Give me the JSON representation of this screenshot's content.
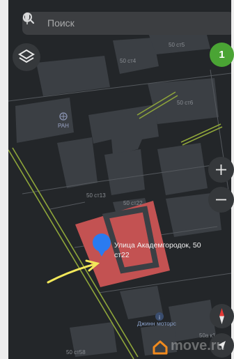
{
  "search": {
    "placeholder": "Поиск"
  },
  "notifications": {
    "count": "1"
  },
  "map": {
    "poi_ran": "РАН",
    "poi_djinn": "Джинн моторс",
    "selected_address_line1": "Улица Академгородок, 50",
    "selected_address_line2": "ст22",
    "building_labels": {
      "st5": "50 ст5",
      "st4": "50 ст4",
      "st6": "50 ст6",
      "st13": "50 ст13",
      "st22": "50 ст22",
      "k1": "50а к1",
      "st58": "50 ст58"
    }
  },
  "watermark": {
    "text": "move.ru"
  },
  "colors": {
    "map_background": "#232629",
    "building": "#3b3f44",
    "selected_building": "#c35252",
    "pin": "#2a7bf0",
    "annotation_arrow": "#f2e85a",
    "badge": "#4aa434",
    "compass_north": "#e53935"
  }
}
